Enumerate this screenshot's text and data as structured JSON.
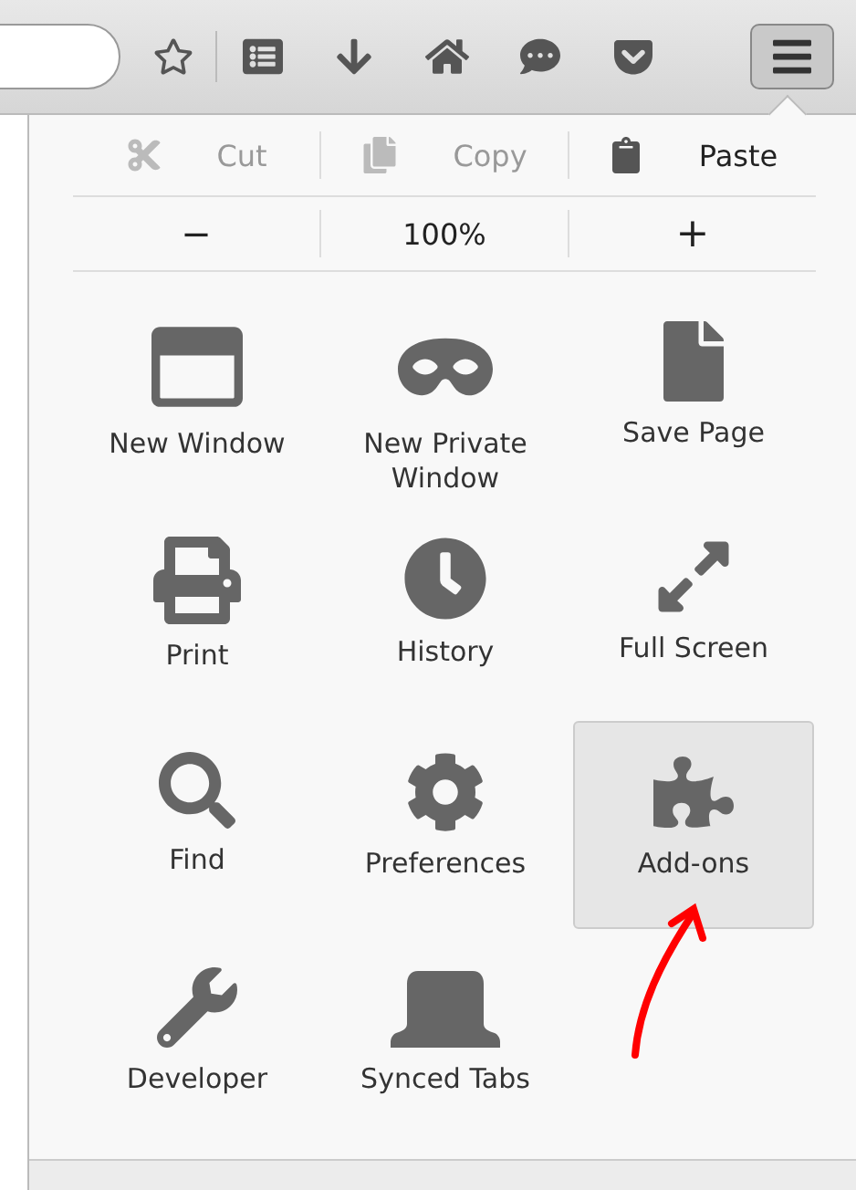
{
  "toolbar": {
    "menu_button": {
      "pressed": true
    }
  },
  "edit_row": [
    {
      "label": "Cut",
      "disabled": true
    },
    {
      "label": "Copy",
      "disabled": true
    },
    {
      "label": "Paste",
      "disabled": false
    }
  ],
  "zoom_row": {
    "zoom_out": "−",
    "level": "100%",
    "zoom_in": "+"
  },
  "items": [
    {
      "label": "New Window",
      "selected": false
    },
    {
      "label": "New Private Window",
      "selected": false
    },
    {
      "label": "Save Page",
      "selected": false
    },
    {
      "label": "Print",
      "selected": false
    },
    {
      "label": "History",
      "selected": false
    },
    {
      "label": "Full Screen",
      "selected": false
    },
    {
      "label": "Find",
      "selected": false
    },
    {
      "label": "Preferences",
      "selected": false
    },
    {
      "label": "Add-ons",
      "selected": true
    },
    {
      "label": "Developer",
      "selected": false
    },
    {
      "label": "Synced Tabs",
      "selected": false
    }
  ]
}
